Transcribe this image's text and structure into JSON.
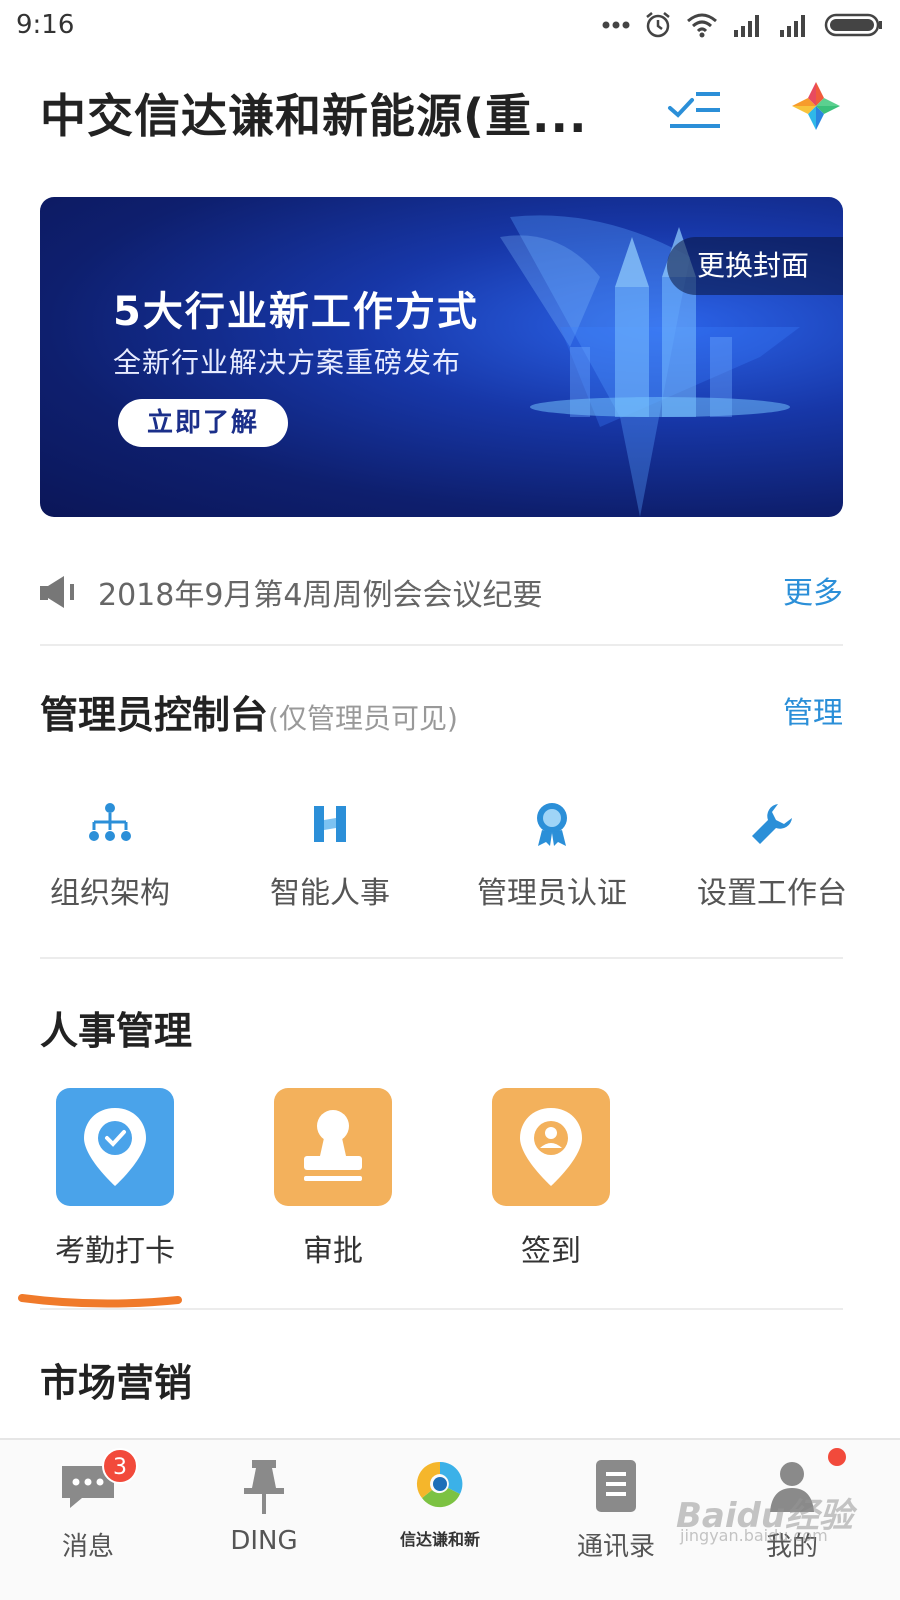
{
  "status_bar": {
    "time": "9:16",
    "icons": [
      "more-dots-icon",
      "alarm-icon",
      "wifi-icon",
      "signal-icon",
      "signal-icon",
      "battery-icon"
    ]
  },
  "header": {
    "title": "中交信达谦和新能源(重...",
    "todo_icon": "task-list-icon",
    "apps_icon": "app-launcher-icon"
  },
  "banner": {
    "headline": "5大行业新工作方式",
    "subtitle": "全新行业解决方案重磅发布",
    "cta": "立即了解",
    "change_cover": "更换封面"
  },
  "announcement": {
    "text": "2018年9月第4周周例会会议纪要",
    "more": "更多"
  },
  "admin_console": {
    "title": "管理员控制台",
    "note": "(仅管理员可见)",
    "manage": "管理",
    "items": [
      {
        "label": "组织架构",
        "icon": "org-chart-icon"
      },
      {
        "label": "智能人事",
        "icon": "smart-hr-icon"
      },
      {
        "label": "管理员认证",
        "icon": "certification-badge-icon"
      },
      {
        "label": "设置工作台",
        "icon": "wrench-icon"
      }
    ]
  },
  "hr": {
    "title": "人事管理",
    "apps": [
      {
        "label": "考勤打卡",
        "icon": "checkin-location-icon",
        "color": "#4aa3ea"
      },
      {
        "label": "审批",
        "icon": "stamp-icon",
        "color": "#f3b15c"
      },
      {
        "label": "签到",
        "icon": "signin-location-icon",
        "color": "#f3b15c"
      }
    ]
  },
  "marketing": {
    "title": "市场营销"
  },
  "bottom_nav": {
    "items": [
      {
        "label": "消息",
        "icon": "chat-bubble-icon",
        "badge": "3"
      },
      {
        "label": "DING",
        "icon": "pin-icon"
      },
      {
        "label": "信达谦和新",
        "icon": "company-logo-icon"
      },
      {
        "label": "通讯录",
        "icon": "contacts-book-icon"
      },
      {
        "label": "我的",
        "icon": "person-icon"
      }
    ]
  },
  "colors": {
    "accent": "#2b8fd8",
    "badge": "#f24a3b",
    "banner": "#1737a8",
    "highlight": "#f07a2a"
  },
  "watermark": {
    "text": "Baidu经验",
    "sub": "jingyan.baidu.com"
  }
}
